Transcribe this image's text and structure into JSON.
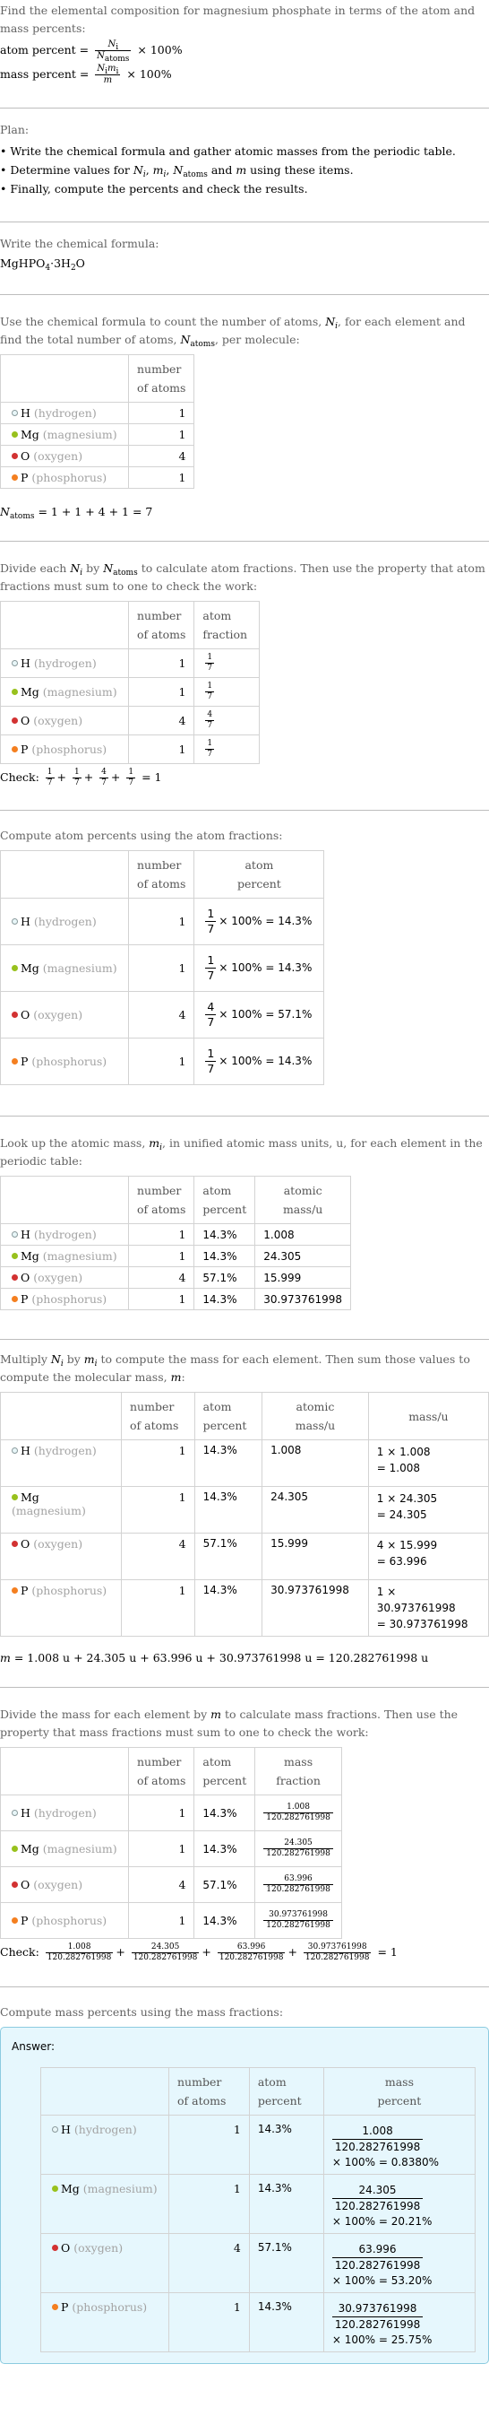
{
  "intro": {
    "text": "Find the elemental composition for magnesium phosphate in terms of the atom and mass percents:",
    "atom_percent_label": "atom percent =",
    "atom_percent_num": "N",
    "atom_percent_num_sub": "i",
    "atom_percent_den": "N",
    "atom_percent_den_sub": "atoms",
    "times_100": "× 100%",
    "mass_percent_label": "mass percent =",
    "mass_percent_num": "N",
    "mass_percent_num_sub": "i",
    "mass_percent_num2": "m",
    "mass_percent_num2_sub": "i",
    "mass_percent_den": "m"
  },
  "plan": {
    "title": "Plan:",
    "items": [
      "• Write the chemical formula and gather atomic masses from the periodic table.",
      "• Determine values for N_i, m_i, N_atoms and m using these items.",
      "• Finally, compute the percents and check the results."
    ]
  },
  "formula": {
    "instruction": "Write the chemical formula:",
    "value_parts": [
      "MgHPO",
      "4",
      "·3H",
      "2",
      "O"
    ]
  },
  "colors": {
    "H": "#e8f6f8",
    "Mg": "#98c11d",
    "O": "#d23232",
    "P": "#f47f20",
    "answer_bg": "#e6f7fd",
    "answer_border": "#8ccbe0"
  },
  "elements": [
    {
      "symbol": "H",
      "name": "(hydrogen)",
      "count": "1",
      "fraction_num": "1",
      "fraction_den": "7",
      "atom_percent_calc": "× 100% = 14.3%",
      "atom_percent": "14.3%",
      "atomic_mass": "1.008",
      "mass_calc_1": "1 × 1.008",
      "mass_calc_2": "= 1.008",
      "mass": "1.008",
      "mass_percent_calc": "× 100% = 0.8380%"
    },
    {
      "symbol": "Mg",
      "name": "(magnesium)",
      "count": "1",
      "fraction_num": "1",
      "fraction_den": "7",
      "atom_percent_calc": "× 100% = 14.3%",
      "atom_percent": "14.3%",
      "atomic_mass": "24.305",
      "mass_calc_1": "1 × 24.305",
      "mass_calc_2": "= 24.305",
      "mass": "24.305",
      "mass_percent_calc": "× 100% = 20.21%"
    },
    {
      "symbol": "O",
      "name": "(oxygen)",
      "count": "4",
      "fraction_num": "4",
      "fraction_den": "7",
      "atom_percent_calc": "× 100% = 57.1%",
      "atom_percent": "57.1%",
      "atomic_mass": "15.999",
      "mass_calc_1": "4 × 15.999",
      "mass_calc_2": "= 63.996",
      "mass": "63.996",
      "mass_percent_calc": "× 100% = 53.20%"
    },
    {
      "symbol": "P",
      "name": "(phosphorus)",
      "count": "1",
      "fraction_num": "1",
      "fraction_den": "7",
      "atom_percent_calc": "× 100% = 14.3%",
      "atom_percent": "14.3%",
      "atomic_mass": "30.973761998",
      "mass_calc_1": "1 ×",
      "mass_calc_1b": "30.973761998",
      "mass_calc_2": "= 30.973761998",
      "mass": "30.973761998",
      "mass_percent_calc": "× 100% = 25.75%"
    }
  ],
  "step_count": {
    "text": "Use the chemical formula to count the number of atoms, N_i, for each element and find the total number of atoms, N_atoms, per molecule:",
    "result": "= 1 + 1 + 4 + 1 = 7"
  },
  "headers": {
    "number_of_atoms_1": "number",
    "number_of_atoms_2": "of atoms",
    "atom_fraction_1": "atom",
    "atom_fraction_2": "fraction",
    "atom_percent_1": "atom",
    "atom_percent_2": "percent",
    "atomic_mass_1": "atomic",
    "atomic_mass_2": "mass/u",
    "mass": "mass/u",
    "mass_fraction_1": "mass",
    "mass_fraction_2": "fraction",
    "mass_percent_1": "mass",
    "mass_percent_2": "percent"
  },
  "step_fraction": {
    "text_1": "Divide each",
    "text_2": "by",
    "text_3": "to calculate atom fractions. Then use the property that atom fractions must sum to one to check the work:",
    "check_label": "Check:",
    "check_result": "= 1"
  },
  "step_atom_percent": {
    "text": "Compute atom percents using the atom fractions:"
  },
  "step_lookup": {
    "text_1": "Look up the atomic mass,",
    "text_2": ", in unified atomic mass units, u, for each element in the periodic table:"
  },
  "step_mass": {
    "text_1": "Multiply",
    "text_2": "by",
    "text_3": "to compute the mass for each element. Then sum those values to compute the molecular mass,",
    "text_4": ":",
    "sum": "= 1.008 u + 24.305 u + 63.996 u + 30.973761998 u = 120.282761998 u"
  },
  "step_mass_fraction": {
    "text_1": "Divide the mass for each element by",
    "text_2": "to calculate mass fractions. Then use the property that mass fractions must sum to one to check the work:",
    "denominator": "120.282761998",
    "check_label": "Check:",
    "check_result": "= 1"
  },
  "step_mass_percent": {
    "text": "Compute mass percents using the mass fractions:",
    "answer_label": "Answer:"
  }
}
